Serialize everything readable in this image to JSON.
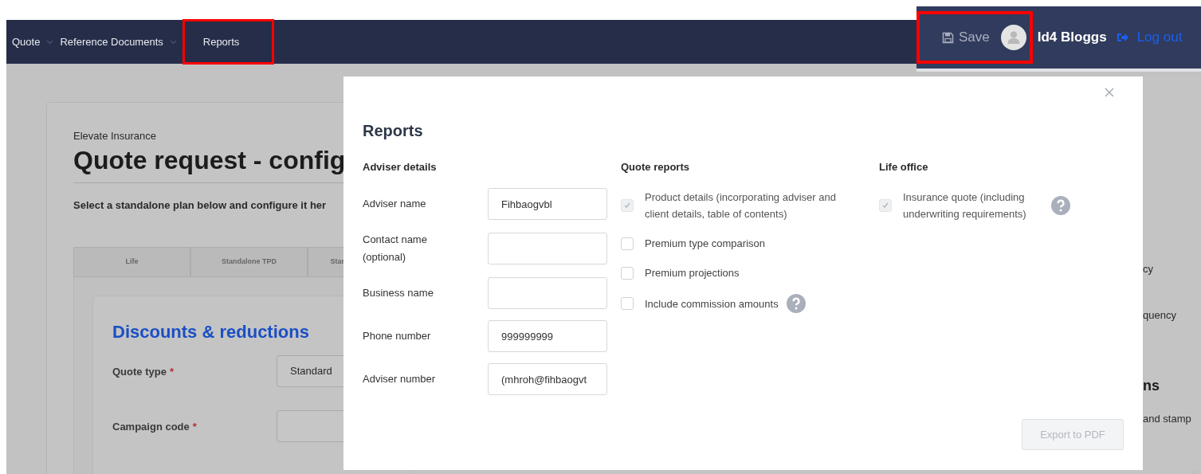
{
  "nav": {
    "items": [
      {
        "label": "Quote",
        "dropdown": true,
        "highlighted": false
      },
      {
        "label": "Reference Documents",
        "dropdown": true,
        "highlighted": false
      },
      {
        "label": "Reports",
        "dropdown": false,
        "highlighted": true
      }
    ]
  },
  "user_bar": {
    "save": "Save",
    "save_highlighted": true,
    "user": "Id4 Bloggs",
    "logout": "Log out"
  },
  "page": {
    "company": "Elevate Insurance",
    "title": "Quote request - config",
    "instruction": "Select a standalone plan below and configure it her",
    "tabs": [
      {
        "label": "Life"
      },
      {
        "label": "Standalone TPD"
      },
      {
        "label": "Star"
      }
    ],
    "section_title": "Discounts & reductions",
    "fields": [
      {
        "label": "Quote type",
        "required_mark": "*",
        "value": "Standard"
      },
      {
        "label": "Campaign code",
        "required_mark": "*"
      }
    ],
    "right_fragments": [
      {
        "text": "cy",
        "kind": "text"
      },
      {
        "text": "quency",
        "kind": "text"
      },
      {
        "text": "ns",
        "kind": "heading"
      },
      {
        "text": "and stamp",
        "kind": "text"
      }
    ]
  },
  "modal": {
    "title": "Reports",
    "adviser_details": {
      "heading": "Adviser details",
      "fields": [
        {
          "label": "Adviser name",
          "value": "Fihbaogvbl"
        },
        {
          "label": "Contact name (optional)"
        },
        {
          "label": "Business name"
        },
        {
          "label": "Phone number",
          "value": "999999999"
        },
        {
          "label": "Adviser number",
          "value": "(mhroh@fihbaogvt"
        }
      ]
    },
    "quote_reports": {
      "heading": "Quote reports",
      "options": [
        {
          "label": "Product details (incorporating adviser and client details, table of contents)",
          "checked": true,
          "disabled": true,
          "help": false
        },
        {
          "label": "Premium type comparison",
          "checked": false,
          "disabled": false,
          "help": false
        },
        {
          "label": "Premium projections",
          "checked": false,
          "disabled": false,
          "help": false
        },
        {
          "label": "Include commission amounts",
          "checked": false,
          "disabled": false,
          "help": true
        }
      ]
    },
    "life_office": {
      "heading": "Life office",
      "options": [
        {
          "label": "Insurance quote (including underwriting requirements)",
          "checked": true,
          "disabled": true,
          "help": true
        }
      ]
    },
    "export_button": {
      "label": "Export to PDF",
      "disabled": true
    }
  }
}
